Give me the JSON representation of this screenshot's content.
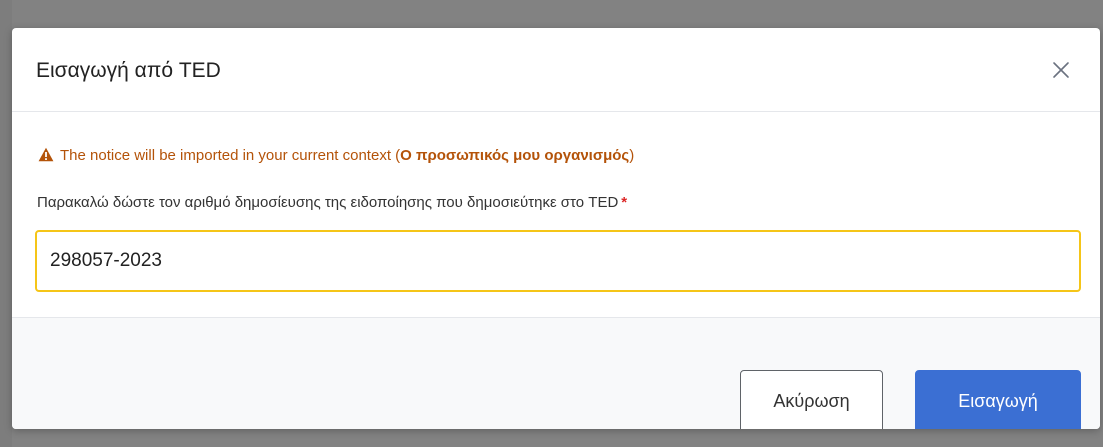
{
  "modal": {
    "title": "Εισαγωγή από TED",
    "close_icon": "close-icon"
  },
  "warning": {
    "icon": "warning-triangle-icon",
    "text": "The notice will be imported in your current context (",
    "context_name": "Ο προσωπικός μου οργανισμός",
    "text_end": ")",
    "color": "#b45309"
  },
  "field": {
    "label": "Παρακαλώ δώστε τον αριθμό δημοσίευσης της ειδοποίησης που δημοσιεύτηκε στο TED",
    "required_marker": "*",
    "value": "298057-2023",
    "focus_color": "#f5c518"
  },
  "footer": {
    "cancel_label": "Ακύρωση",
    "import_label": "Εισαγωγή",
    "primary_color": "#3b6fd3"
  }
}
